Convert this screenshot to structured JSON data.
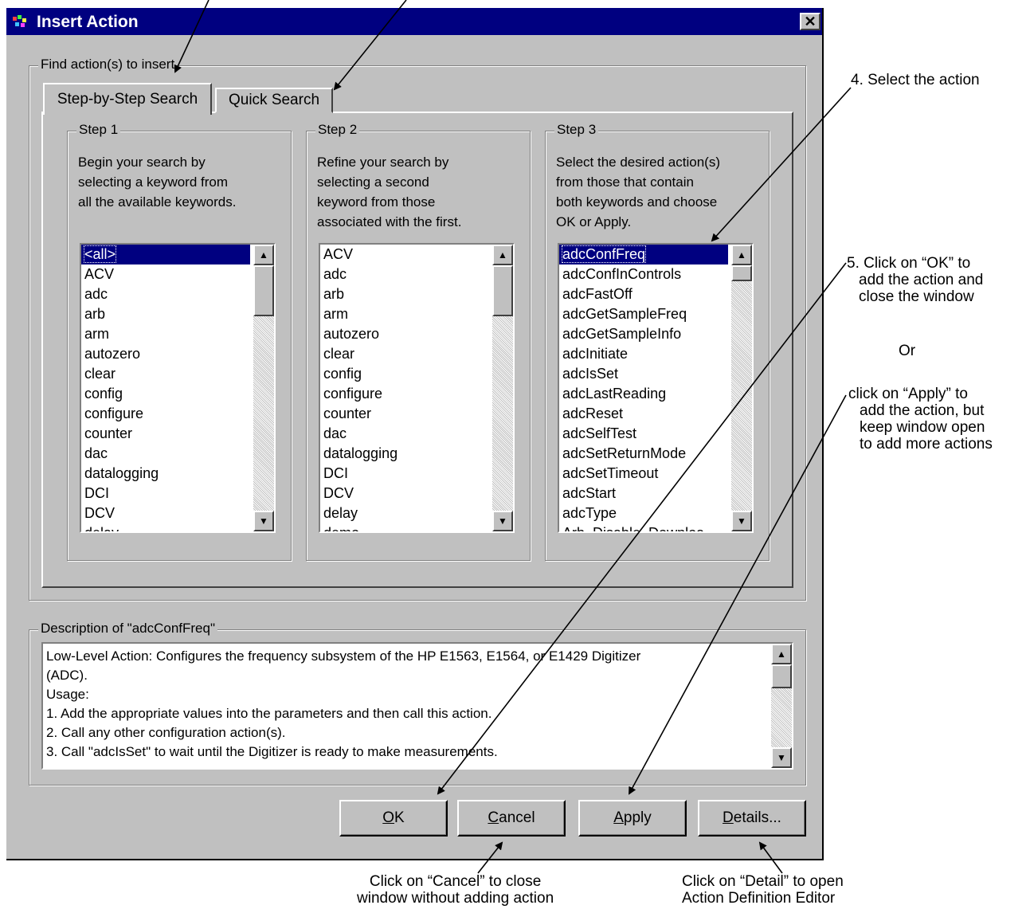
{
  "window": {
    "title": "Insert Action",
    "close_glyph": "✕",
    "find_group_label": "Find action(s) to insert",
    "tabs": [
      {
        "label": "Step-by-Step Search",
        "active": true
      },
      {
        "label": "Quick Search",
        "active": false
      }
    ],
    "steps": [
      {
        "title": "Step 1",
        "description": [
          "Begin your search by",
          "selecting a keyword from",
          "all the available keywords."
        ],
        "items": [
          "<all>",
          "ACV",
          "adc",
          "arb",
          "arm",
          "autozero",
          "clear",
          "config",
          "configure",
          "counter",
          "dac",
          "datalogging",
          "DCI",
          "DCV",
          "delay"
        ],
        "selected_index": 0
      },
      {
        "title": "Step 2",
        "description": [
          "Refine your search by",
          "selecting a second",
          "keyword from those",
          "associated with the first."
        ],
        "items": [
          "ACV",
          "adc",
          "arb",
          "arm",
          "autozero",
          "clear",
          "config",
          "configure",
          "counter",
          "dac",
          "datalogging",
          "DCI",
          "DCV",
          "delay",
          "demo"
        ],
        "selected_index": -1
      },
      {
        "title": "Step 3",
        "description": [
          "Select the desired action(s)",
          "from those that contain",
          "both keywords and choose",
          "OK or Apply."
        ],
        "items": [
          "adcConfFreq",
          "adcConfInControls",
          "adcFastOff",
          "adcGetSampleFreq",
          "adcGetSampleInfo",
          "adcInitiate",
          "adcIsSet",
          "adcLastReading",
          "adcReset",
          "adcSelfTest",
          "adcSetReturnMode",
          "adcSetTimeout",
          "adcStart",
          "adcType",
          "Arb_Disable_Downloa"
        ],
        "selected_index": 0
      }
    ],
    "description_group_label": "Description of \"adcConfFreq\"",
    "description_lines": [
      "Low-Level Action: Configures the frequency subsystem of the HP E1563, E1564, or E1429 Digitizer",
      "(ADC).",
      "Usage:",
      "1. Add the appropriate values into the parameters and then call this action.",
      "2. Call any other configuration action(s).",
      "3. Call \"adcIsSet\" to wait until the Digitizer is ready to make measurements."
    ],
    "buttons": {
      "ok": {
        "accel": "O",
        "rest": "K"
      },
      "cancel": {
        "accel": "C",
        "rest": "ancel"
      },
      "apply": {
        "accel": "A",
        "rest": "pply"
      },
      "details": {
        "accel": "D",
        "rest": "etails..."
      }
    }
  },
  "annotations": {
    "select_action": "4. Select the action",
    "ok_note": [
      "5. Click on “OK” to",
      "add the action and",
      "close the window"
    ],
    "or": "Or",
    "apply_note": [
      "click on “Apply” to",
      "add the action, but",
      "keep window open",
      "to add more actions"
    ],
    "cancel_note": [
      "Click on “Cancel” to close",
      "window without adding action"
    ],
    "details_note": [
      "Click on “Detail” to open",
      "Action Definition Editor"
    ]
  }
}
